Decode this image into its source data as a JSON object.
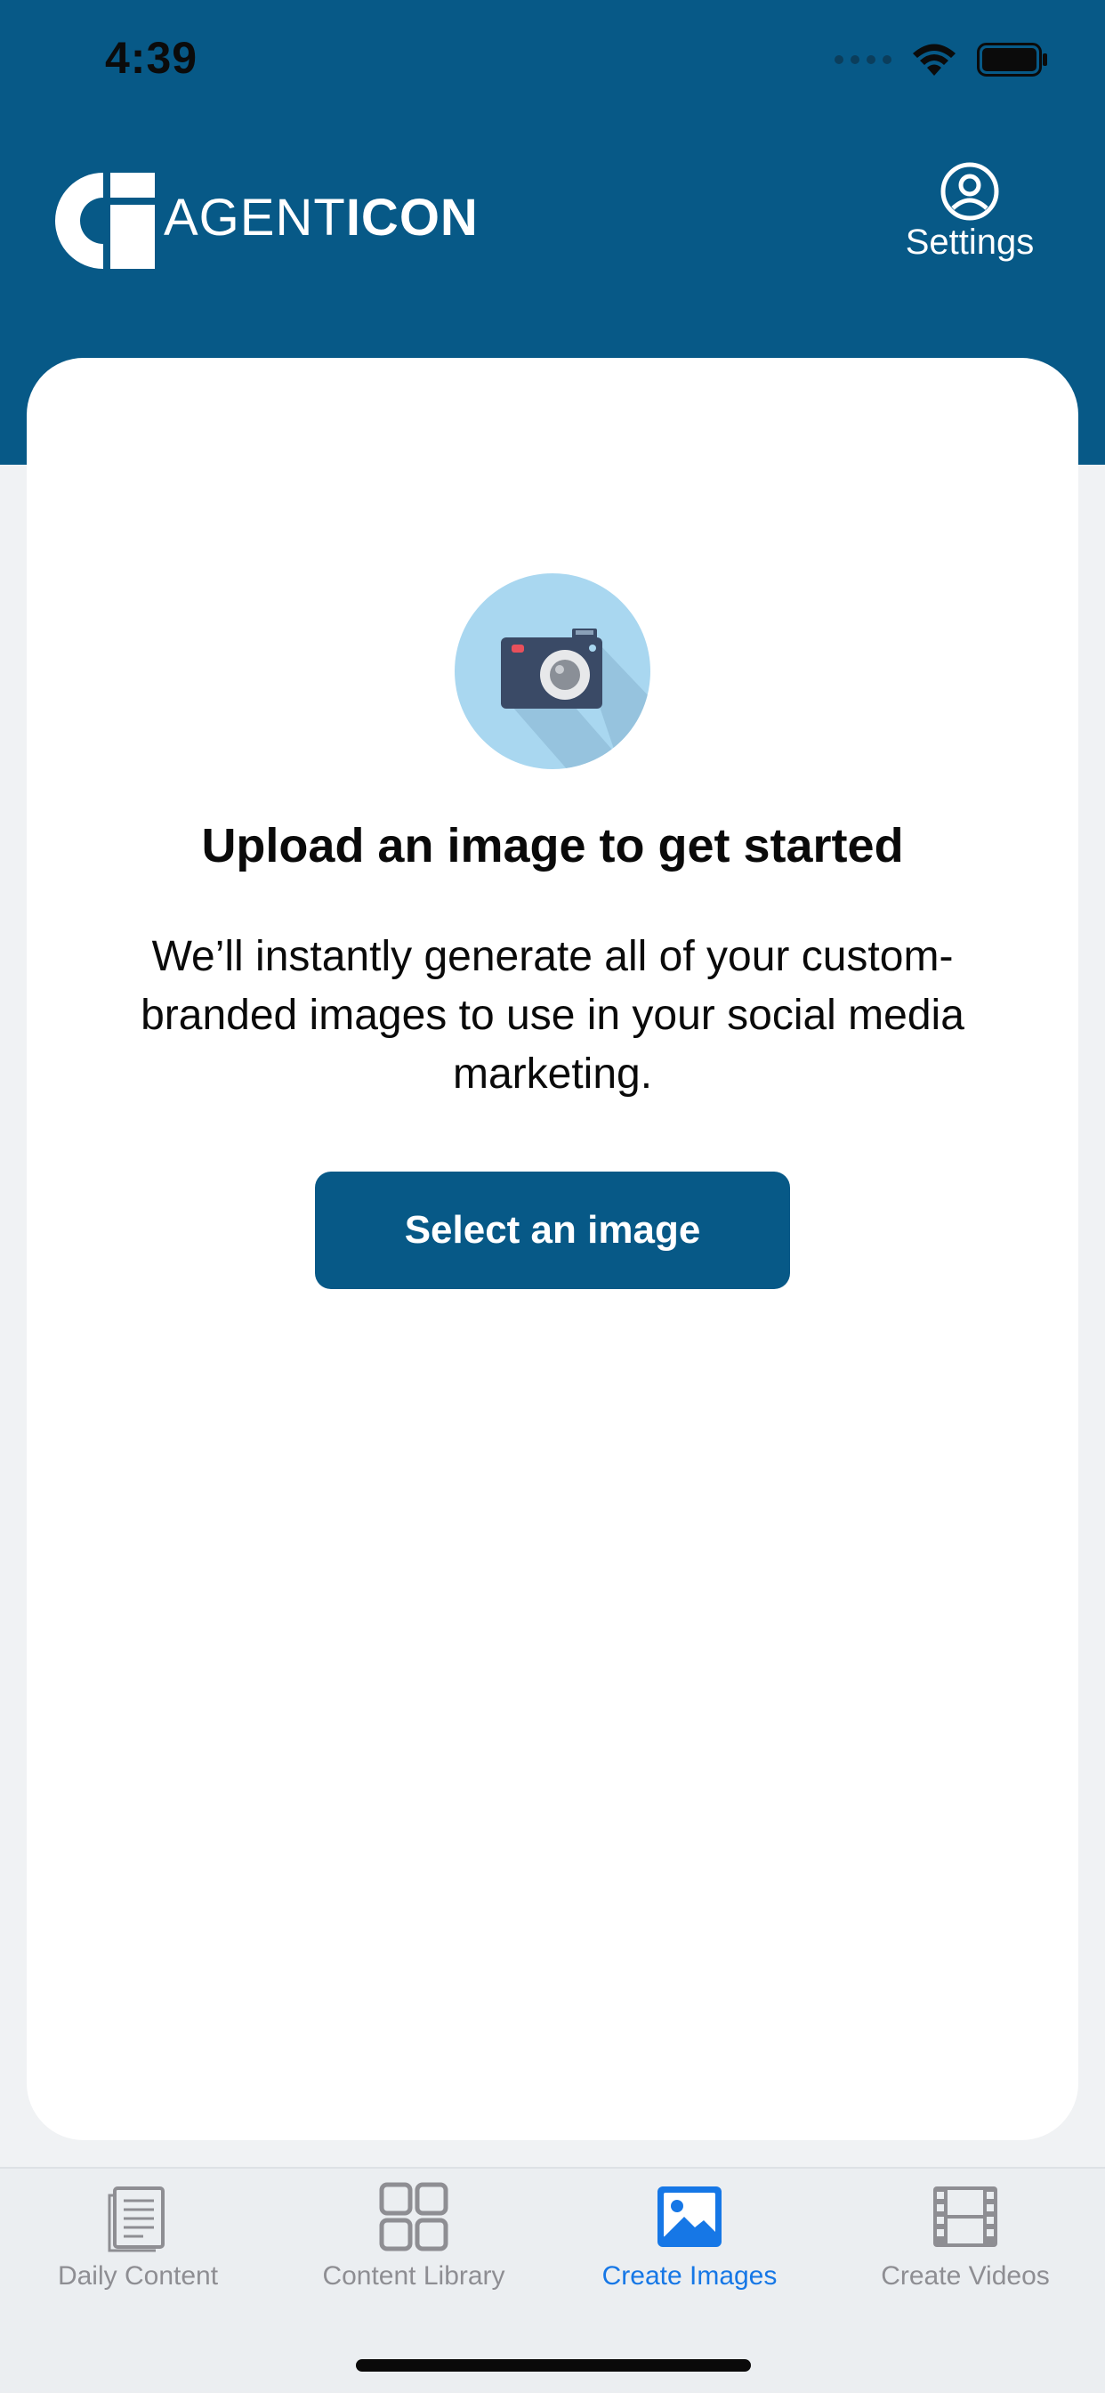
{
  "status_bar": {
    "time": "4:39"
  },
  "header": {
    "logo_text_light": "AGENT",
    "logo_text_bold": "ICON",
    "settings_label": "Settings"
  },
  "main": {
    "title": "Upload an image to get started",
    "description": "We’ll instantly generate all of your custom-branded images to use in your social media marketing.",
    "button_label": "Select an image"
  },
  "tabs": [
    {
      "label": "Daily Content",
      "icon": "document-icon",
      "active": false
    },
    {
      "label": "Content Library",
      "icon": "grid-icon",
      "active": false
    },
    {
      "label": "Create Images",
      "icon": "image-icon",
      "active": true
    },
    {
      "label": "Create Videos",
      "icon": "film-icon",
      "active": false
    }
  ],
  "colors": {
    "brand": "#075987",
    "active_tab": "#1677e6",
    "inactive_tab": "#8e8e93",
    "background": "#f0f2f4"
  }
}
